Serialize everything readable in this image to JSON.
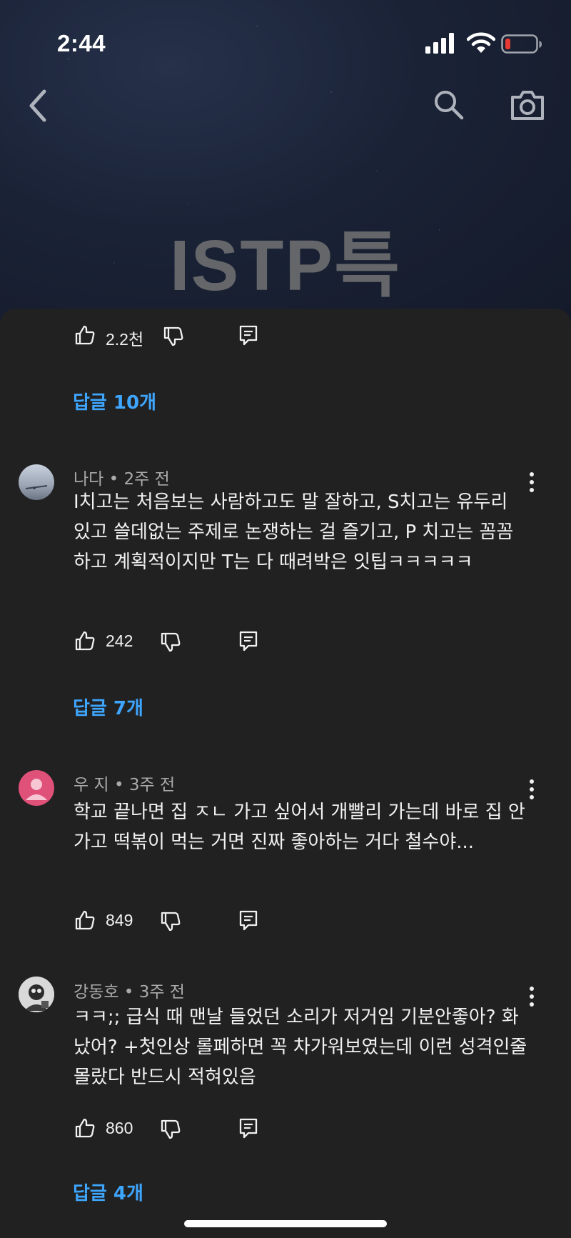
{
  "status_bar": {
    "time": "2:44"
  },
  "header": {
    "title": "ISTP특"
  },
  "top_actions": {
    "likes": "2.2천"
  },
  "top_replies": "답글 10개",
  "comments": [
    {
      "author": "나다",
      "age": "2주 전",
      "text": "I치고는 처음보는 사람하고도 말 잘하고, S치고는 유두리 있고 쓸데없는 주제로 논쟁하는 걸 즐기고, P 치고는 꼼꼼하고 계획적이지만 T는 다 때려박은 잇팁ㅋㅋㅋㅋㅋ",
      "likes": "242",
      "replies": "답글 7개"
    },
    {
      "author": "우 지",
      "age": "3주 전",
      "text": "학교 끝나면 집 ㅈㄴ 가고 싶어서 개빨리 가는데 바로 집 안 가고 떡볶이 먹는 거면 진짜 좋아하는 거다 철수야...",
      "likes": "849"
    },
    {
      "author": "강동호",
      "age": "3주 전",
      "text": "ㅋㅋ;; 급식 때 맨날 들었던 소리가 저거임 기분안좋아? 화났어? +첫인상 롤페하면 꼭 차가워보였는데 이런 성격인줄 몰랐다 반드시 적혀있음",
      "likes": "860",
      "replies": "답글 4개"
    }
  ],
  "separator": "•",
  "colors": {
    "background": "#212121",
    "link": "#3ea6ff",
    "battery_low": "#e53935"
  }
}
